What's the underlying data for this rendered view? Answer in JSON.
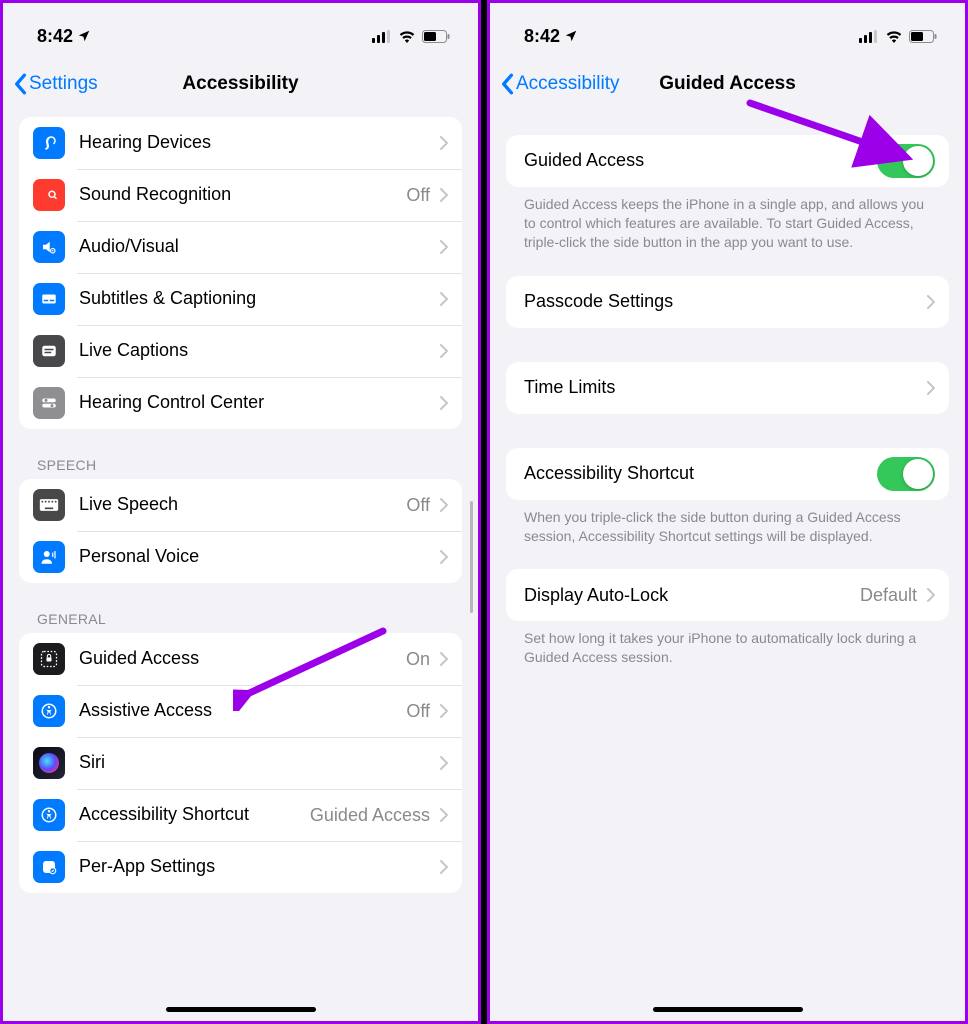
{
  "statusbar": {
    "time": "8:42"
  },
  "left": {
    "back_label": "Settings",
    "title": "Accessibility",
    "hearing_group": {
      "hearing_devices": "Hearing Devices",
      "sound_recognition": "Sound Recognition",
      "sound_recognition_value": "Off",
      "audio_visual": "Audio/Visual",
      "subtitles": "Subtitles & Captioning",
      "live_captions": "Live Captions",
      "hearing_cc": "Hearing Control Center"
    },
    "speech_header": "Speech",
    "speech": {
      "live_speech": "Live Speech",
      "live_speech_value": "Off",
      "personal_voice": "Personal Voice"
    },
    "general_header": "General",
    "general": {
      "guided_access": "Guided Access",
      "guided_access_value": "On",
      "assistive_access": "Assistive Access",
      "assistive_access_value": "Off",
      "siri": "Siri",
      "a11y_shortcut": "Accessibility Shortcut",
      "a11y_shortcut_value": "Guided Access",
      "per_app": "Per-App Settings"
    }
  },
  "right": {
    "back_label": "Accessibility",
    "title": "Guided Access",
    "toggle_label": "Guided Access",
    "toggle_footer": "Guided Access keeps the iPhone in a single app, and allows you to control which features are available. To start Guided Access, triple-click the side button in the app you want to use.",
    "passcode": "Passcode Settings",
    "time_limits": "Time Limits",
    "shortcut_label": "Accessibility Shortcut",
    "shortcut_footer": "When you triple-click the side button during a Guided Access session, Accessibility Shortcut settings will be displayed.",
    "autolock": "Display Auto-Lock",
    "autolock_value": "Default",
    "autolock_footer": "Set how long it takes your iPhone to automatically lock during a Guided Access session."
  }
}
